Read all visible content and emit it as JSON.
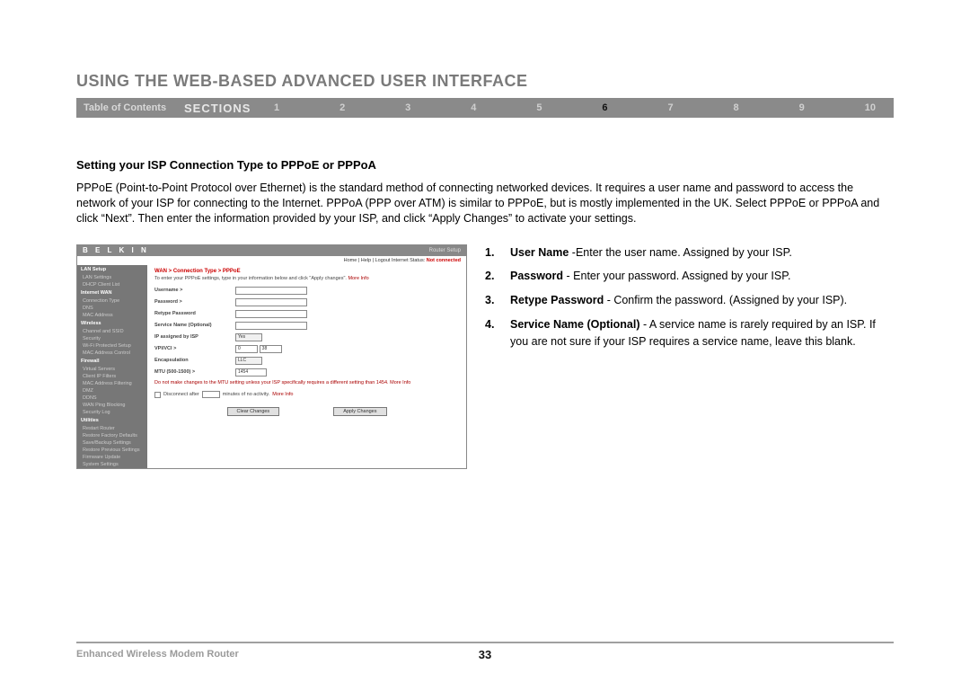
{
  "page": {
    "title": "USING THE WEB-BASED ADVANCED USER INTERFACE",
    "toc_label": "Table of Contents",
    "sections_label": "SECTIONS",
    "section_numbers": [
      "1",
      "2",
      "3",
      "4",
      "5",
      "6",
      "7",
      "8",
      "9",
      "10"
    ],
    "active_section": "6"
  },
  "content": {
    "subheading": "Setting your ISP Connection Type to PPPoE or PPPoA",
    "paragraph": "PPPoE (Point-to-Point Protocol over Ethernet) is the standard method of connecting networked devices. It requires a user name and password to access the network of your ISP for connecting to the Internet. PPPoA (PPP over ATM) is similar to PPPoE, but is mostly implemented in the UK. Select PPPoE or PPPoA and click “Next”. Then enter the information provided by your ISP, and click “Apply Changes” to activate your settings."
  },
  "list": [
    {
      "num": "1.",
      "label": "User Name",
      "text": " -Enter the user name. Assigned by your ISP."
    },
    {
      "num": "2.",
      "label": "Password",
      "text": " - Enter your password. Assigned by your ISP."
    },
    {
      "num": "3.",
      "label": "Retype Password",
      "text": " - Confirm the password. (Assigned by your ISP)."
    },
    {
      "num": "4.",
      "label": "Service Name (Optional)",
      "text": " - A service name is rarely required by an ISP. If you are not sure if your ISP requires a service name, leave this blank."
    }
  ],
  "router": {
    "brand": "B E L K I N",
    "setup_label": "Router Setup",
    "top_links": "Home | Help | Logout   Internet Status:",
    "status": "Not connected",
    "breadcrumb": "WAN > Connection Type > PPPoE",
    "intro": "To enter your PPPoE settings, type in your information below and click \"Apply changes\".",
    "more_info": "More Info",
    "sidebar": {
      "groups": [
        {
          "header": "LAN Setup",
          "items": [
            "LAN Settings",
            "DHCP Client List"
          ]
        },
        {
          "header": "Internet WAN",
          "items": [
            "Connection Type",
            "DNS",
            "MAC Address"
          ]
        },
        {
          "header": "Wireless",
          "items": [
            "Channel and SSID",
            "Security",
            "Wi-Fi Protected Setup",
            "MAC Address Control"
          ]
        },
        {
          "header": "Firewall",
          "items": [
            "Virtual Servers",
            "Client IP Filters",
            "MAC Address Filtering",
            "DMZ",
            "DDNS",
            "WAN Ping Blocking",
            "Security Log"
          ]
        },
        {
          "header": "Utilities",
          "items": [
            "Restart Router",
            "Restore Factory Defaults",
            "Save/Backup Settings",
            "Restore Previous Settings",
            "Firmware Update",
            "System Settings"
          ]
        }
      ]
    },
    "fields": {
      "username_lbl": "Username >",
      "password_lbl": "Password >",
      "retype_lbl": "Retype Password",
      "service_lbl": "Service Name (Optional)",
      "ipassigned_lbl": "IP assigned by ISP",
      "ipassigned_val": "Yes",
      "vpivci_lbl": "VPI/VCI >",
      "vpi_val": "0",
      "vci_val": "38",
      "encap_lbl": "Encapsulation",
      "encap_val": "LLC",
      "mtu_lbl": "MTU (500-1500) >",
      "mtu_val": "1454",
      "mtu_note": "Do not make changes to the MTU setting unless your ISP specifically requires a different setting than 1454.",
      "mtu_more": "More Info",
      "disconnect_lbl1": "Disconnect after",
      "disconnect_lbl2": "minutes of no activity.",
      "disconnect_more": "More Info"
    },
    "buttons": {
      "clear": "Clear Changes",
      "apply": "Apply Changes"
    }
  },
  "footer": {
    "product": "Enhanced Wireless Modem Router",
    "page_number": "33"
  }
}
